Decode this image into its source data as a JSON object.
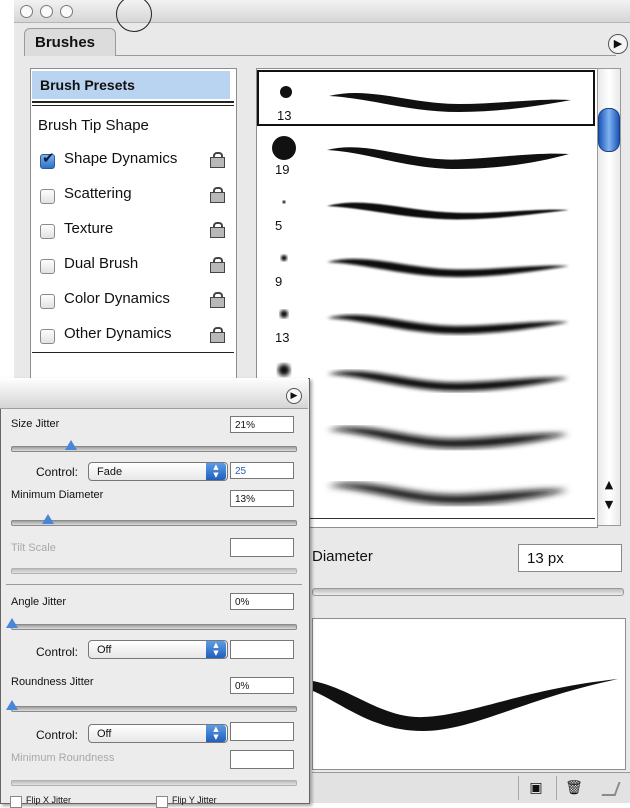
{
  "window": {
    "title_dots": [
      "close",
      "minimize",
      "zoom"
    ],
    "tab_label": "Brushes"
  },
  "left_list": {
    "presets": "Brush Presets",
    "tip_shape": "Brush Tip Shape",
    "items": [
      {
        "label": "Shape Dynamics",
        "checked": true
      },
      {
        "label": "Scattering",
        "checked": false
      },
      {
        "label": "Texture",
        "checked": false
      },
      {
        "label": "Dual Brush",
        "checked": false
      },
      {
        "label": "Color Dynamics",
        "checked": false
      },
      {
        "label": "Other Dynamics",
        "checked": false
      }
    ]
  },
  "brushes": [
    {
      "size": "13"
    },
    {
      "size": "19"
    },
    {
      "size": "5"
    },
    {
      "size": "9"
    },
    {
      "size": "13"
    },
    {
      "size": ""
    },
    {
      "size": ""
    },
    {
      "size": ""
    }
  ],
  "diameter": {
    "label": "Diameter",
    "value": "13 px"
  },
  "shape_dynamics": {
    "size_jitter_label": "Size Jitter",
    "size_jitter_value": "21%",
    "control_label": "Control:",
    "size_control": "Fade",
    "fade_steps": "25",
    "min_diameter_label": "Minimum Diameter",
    "min_diameter_value": "13%",
    "tilt_scale_label": "Tilt Scale",
    "angle_jitter_label": "Angle Jitter",
    "angle_jitter_value": "0%",
    "angle_control": "Off",
    "roundness_jitter_label": "Roundness Jitter",
    "roundness_jitter_value": "0%",
    "roundness_control": "Off",
    "min_roundness_label": "Minimum Roundness",
    "flip_x_label": "Flip X Jitter",
    "flip_y_label": "Flip Y Jitter",
    "size_jitter_level": 0.21,
    "min_diameter_level": 0.13,
    "angle_jitter_level": 0.0,
    "roundness_jitter_level": 0.0
  },
  "icons": {
    "panel_menu": "panel-menu-icon",
    "lock": "lock-icon",
    "new_brush": "new-brush-icon",
    "trash": "trash-icon"
  },
  "colors": {
    "selection": "#b9d4f0",
    "scroll_thumb": "#2f6fd0",
    "slider_thumb": "#4a86d6"
  }
}
